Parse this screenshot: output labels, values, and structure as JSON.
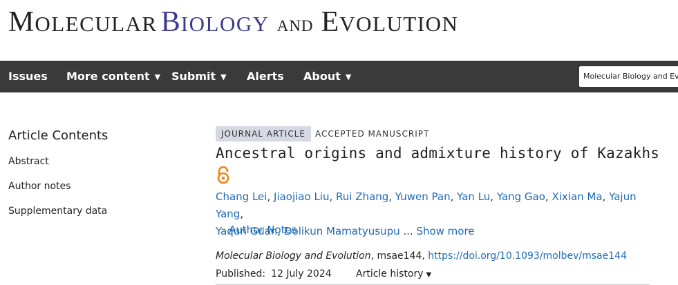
{
  "masthead": {
    "m": "M",
    "olecular": "OLECULAR",
    "b": "B",
    "iology": "IOLOGY",
    "and": "AND",
    "e": "E",
    "volution": "VOLUTION",
    "brand_color": "#3b3b8c"
  },
  "nav": {
    "items": [
      {
        "label": "Issues",
        "has_dropdown": false
      },
      {
        "label": "More content",
        "has_dropdown": true
      },
      {
        "label": "Submit",
        "has_dropdown": true
      },
      {
        "label": "Alerts",
        "has_dropdown": false
      },
      {
        "label": "About",
        "has_dropdown": true
      }
    ],
    "caret": "▼",
    "search_value": "Molecular Biology and Evolution",
    "background": "#3a3a3a"
  },
  "sidebar": {
    "title": "Article Contents",
    "links": [
      "Abstract",
      "Author notes",
      "Supplementary data"
    ]
  },
  "article": {
    "type_badge": "JOURNAL ARTICLE",
    "status": "ACCEPTED MANUSCRIPT",
    "title": "Ancestral origins and admixture history of Kazakhs",
    "open_access_icon": "open-access-lock-icon",
    "authors": [
      "Chang Lei",
      "Jiaojiao Liu",
      "Rui Zhang",
      "Yuwen Pan",
      "Yan Lu",
      "Yang Gao",
      "Xixian Ma",
      "Yajun Yang",
      "Yaqun Guan",
      "Dolikun Mamatyusupu"
    ],
    "separator": ", ",
    "ellipsis": " ... ",
    "show_more": "Show more",
    "author_notes": "Author Notes",
    "citation_journal": "Molecular Biology and Evolution",
    "citation_id": ", msae144, ",
    "doi": "https://doi.org/10.1093/molbev/msae144",
    "published_label": "Published:",
    "published_date": "12 July 2024",
    "history_label": "Article history",
    "history_caret": "▼",
    "link_color": "#1f6bb5"
  }
}
